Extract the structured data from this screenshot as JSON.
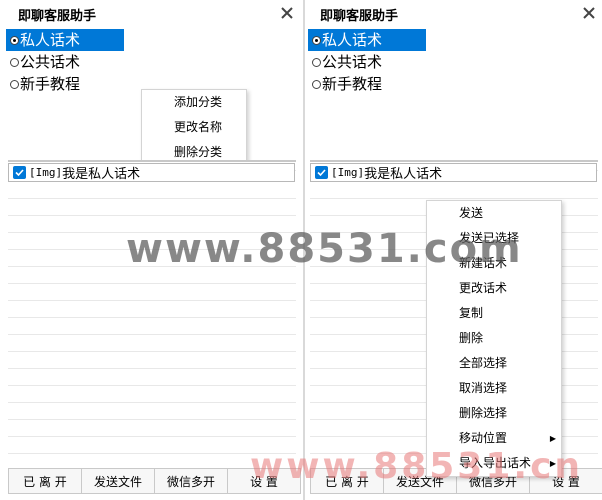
{
  "app_title": "即聊客服助手",
  "categories": [
    {
      "label": "私人话术",
      "selected": true
    },
    {
      "label": "公共话术",
      "selected": false
    },
    {
      "label": "新手教程",
      "selected": false
    }
  ],
  "list_items": [
    {
      "tag": "[Img]",
      "text": "我是私人话术",
      "checked": true
    }
  ],
  "bottom_buttons": [
    "已 离 开",
    "发送文件",
    "微信多开",
    "设 置"
  ],
  "category_menu": [
    "添加分类",
    "更改名称",
    "删除分类"
  ],
  "item_menu": [
    {
      "label": "发送"
    },
    {
      "label": "发送已选择"
    },
    {
      "label": "新建话术"
    },
    {
      "label": "更改话术"
    },
    {
      "label": "复制"
    },
    {
      "label": "删除"
    },
    {
      "label": "全部选择"
    },
    {
      "label": "取消选择"
    },
    {
      "label": "删除选择"
    },
    {
      "label": "移动位置",
      "submenu": true
    },
    {
      "label": "导入导出话术",
      "submenu": true
    }
  ],
  "watermark": {
    "center": "www.88531.com",
    "corner": "www.88531.cn"
  },
  "colors": {
    "accent": "#0078d7",
    "watermark_gray": "#808080",
    "watermark_red": "#e88b8b"
  }
}
